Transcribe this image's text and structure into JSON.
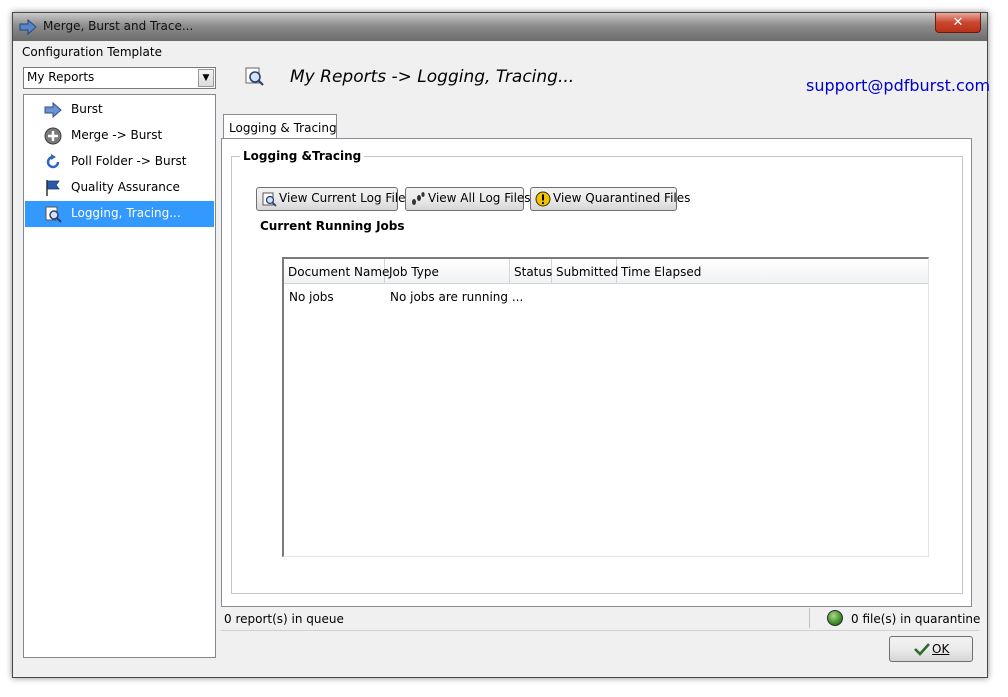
{
  "window": {
    "title": "Merge, Burst and Trace...",
    "close_label": "✕"
  },
  "left_panel": {
    "config_label": "Configuration Template",
    "template_select": {
      "value": "My Reports"
    },
    "tree": [
      {
        "label": "Burst",
        "icon": "arrow-right-icon",
        "selected": false
      },
      {
        "label": "Merge -> Burst",
        "icon": "merge-plus-icon",
        "selected": false
      },
      {
        "label": "Poll Folder -> Burst",
        "icon": "refresh-icon",
        "selected": false
      },
      {
        "label": "Quality Assurance",
        "icon": "flag-icon",
        "selected": false
      },
      {
        "label": "Logging, Tracing...",
        "icon": "magnifier-icon",
        "selected": true
      }
    ]
  },
  "header": {
    "title": "My Reports -> Logging, Tracing...",
    "support_link": "support@pdfburst.com"
  },
  "tabs": [
    {
      "label": "Logging & Tracing",
      "active": true
    }
  ],
  "group": {
    "title": "Logging &Tracing",
    "buttons": {
      "view_current_log": "View Current Log File",
      "view_all_logs": "View All Log Files",
      "view_quarantined": "View Quarantined Files"
    },
    "running_jobs_label": "Current Running Jobs"
  },
  "jobs_table": {
    "columns": [
      "Document Name",
      "Job Type",
      "Status",
      "Submitted",
      "Time Elapsed"
    ],
    "rows": [
      [
        "No jobs",
        "No jobs are running ...",
        "",
        "",
        ""
      ]
    ]
  },
  "status": {
    "queue_text": "0 report(s) in queue",
    "quarantine_text": "0 file(s) in quarantine"
  },
  "footer": {
    "ok_label": "OK"
  },
  "colors": {
    "selection": "#3399ff",
    "link": "#0000cc",
    "window_bg": "#f0f0f0"
  }
}
